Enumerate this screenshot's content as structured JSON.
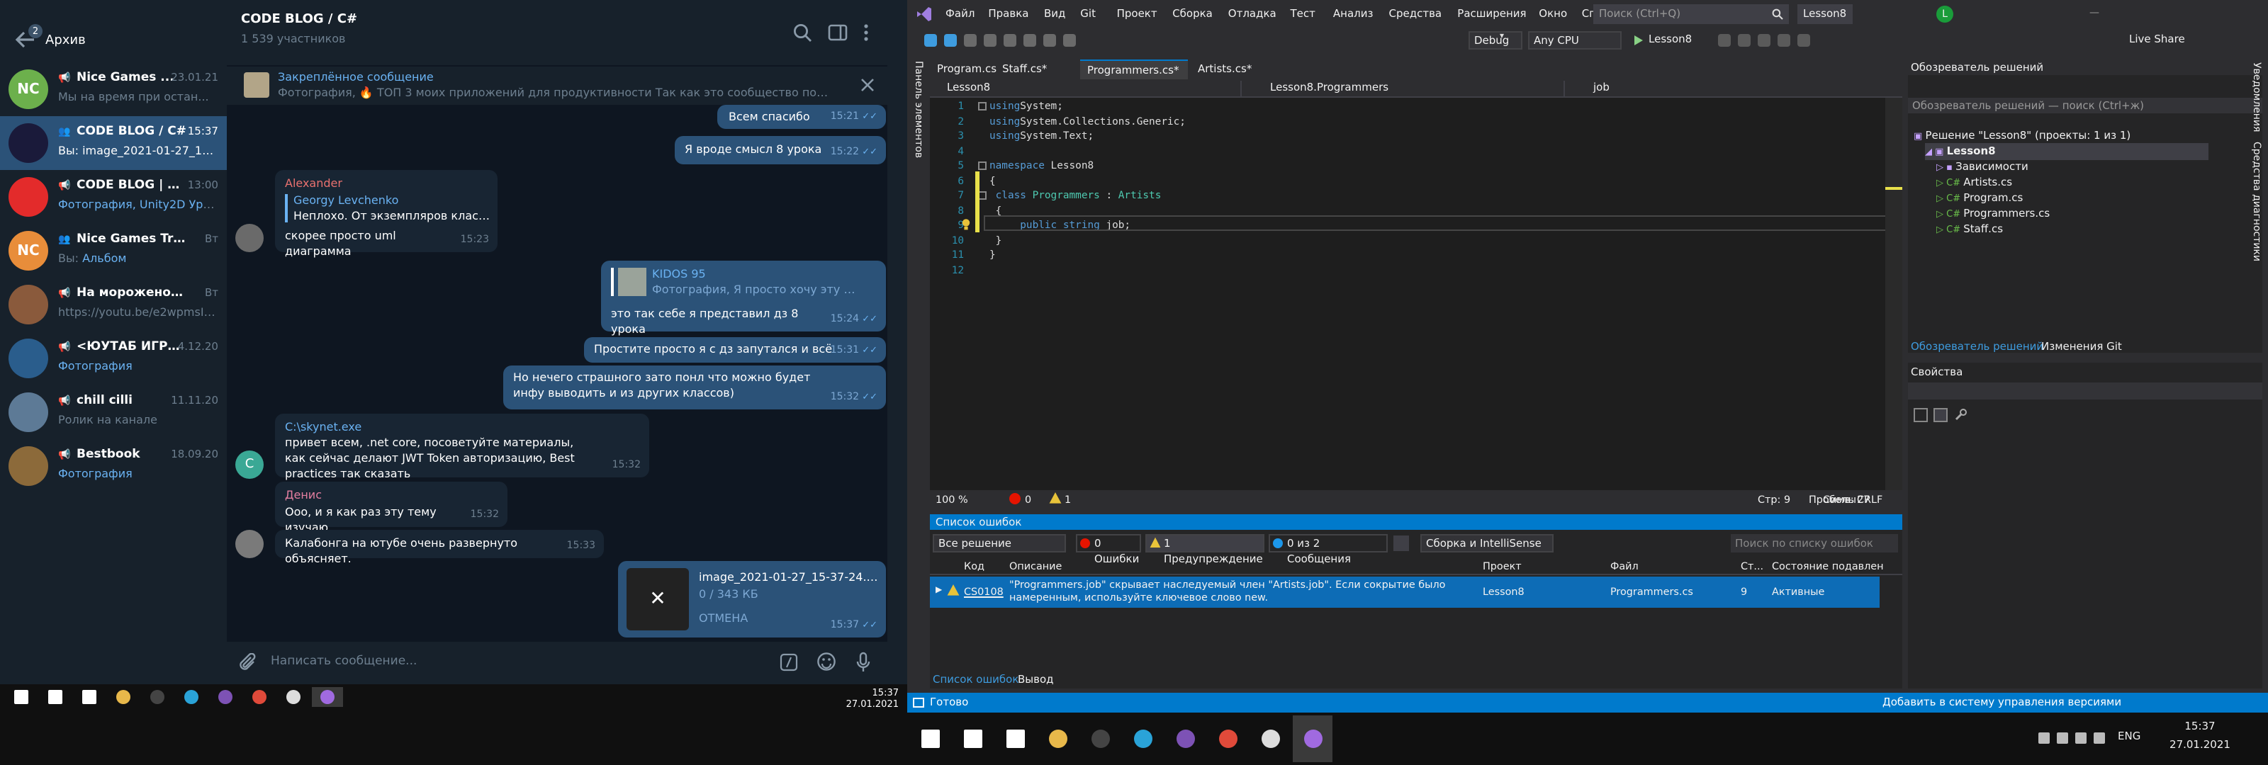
{
  "telegram": {
    "archive": {
      "label": "Архив",
      "badge": "2"
    },
    "chats": [
      {
        "avatar_text": "NC",
        "avatar_color": "#6cb04c",
        "title": "Nice Games ...",
        "time": "23.01.21",
        "sender": "",
        "preview": "Мы на время при остан...",
        "icon": "megaphone-icon",
        "active": false
      },
      {
        "avatar_text": "",
        "avatar_color": "#1a1a3a",
        "title": "CODE BLOG / C#",
        "time": "15:37",
        "sender": "Вы: ",
        "preview": "image_2021-01-27_15-37...",
        "icon": "group-icon",
        "active": true
      },
      {
        "avatar_text": "",
        "avatar_color": "#e32b2b",
        "title": "CODE BLOG | Про...",
        "time": "13:00",
        "sender": "",
        "preview": "Фотография, Unity2D Уроки...",
        "icon": "megaphone-icon",
        "active": false
      },
      {
        "avatar_text": "NC",
        "avatar_color": "#e88d3a",
        "title": "Nice Games Traini...",
        "time": "Вт",
        "sender": "Вы: ",
        "preview": "Альбом",
        "icon": "group-icon",
        "active": false
      },
      {
        "avatar_text": "",
        "avatar_color": "#8a5a3c",
        "title": "На мороженое актеру",
        "time": "Вт",
        "sender": "",
        "preview": "https://youtu.be/e2wpmsIJmf0",
        "icon": "megaphone-icon",
        "active": false
      },
      {
        "avatar_text": "",
        "avatar_color": "#2a5d8c",
        "title": "<ЮУТАБ ИГРЫ>",
        "time": "4.12.20",
        "sender": "",
        "preview": "Фотография",
        "icon": "megaphone-icon",
        "active": false
      },
      {
        "avatar_text": "",
        "avatar_color": "#5d7a96",
        "title": "chill cilli",
        "time": "11.11.20",
        "sender": "",
        "preview": "Ролик на канале",
        "icon": "megaphone-icon",
        "active": false
      },
      {
        "avatar_text": "",
        "avatar_color": "#8c6a3a",
        "title": "Bestbook",
        "time": "18.09.20",
        "sender": "",
        "preview": "Фотография",
        "icon": "megaphone-icon",
        "active": false
      }
    ],
    "header": {
      "title": "CODE BLOG / C#",
      "subtitle": "1 539 участников"
    },
    "pinned": {
      "title": "Закреплённое сообщение",
      "text": "Фотография, 🔥 ТОП 3 моих приложений для продуктивности  Так как это сообщество посвящено и..."
    },
    "messages": [
      {
        "text": "Всем спасибо",
        "time": "15:21"
      },
      {
        "text": "Я вроде смысл 8 урока",
        "time": "15:22"
      },
      {
        "sender": "Alexander",
        "reply_name": "Georgy Levchenko",
        "reply_text": "Неплохо. От экземпляров класса ...",
        "text": "скорее просто uml диаграмма",
        "time": "15:23"
      },
      {
        "reply_name": "KIDOS 95",
        "reply_text": "Фотография, Я просто хочу эту штук...",
        "text": "это так себе я представил дз 8 урока",
        "time": "15:24"
      },
      {
        "text": "Простите просто я с дз запутался и всё",
        "time": "15:31"
      },
      {
        "text": "Но нечего страшного зато понл что можно будет инфу выводить и из  других классов)",
        "time": "15:32"
      },
      {
        "sender": "C:\\skynet.exe",
        "avatar_text": "C",
        "text": "привет всем, .net core, посоветуйте материалы, как сейчас делают JWT Token авторизацию, Best practices так сказать",
        "time": "15:32"
      },
      {
        "sender": "Денис",
        "text": "Ооо, и я как раз эту тему изучаю",
        "time": "15:32"
      },
      {
        "text": "Калабонга на ютубе очень развернуто объясняет.",
        "time": "15:33"
      },
      {
        "file_name": "image_2021-01-27_15-37-24.png",
        "file_size": "0 / 343 КБ",
        "cancel": "ОТМЕНА",
        "time": "15:37"
      }
    ],
    "input_placeholder": "Написать сообщение...",
    "taskbar_clock": {
      "time": "15:37",
      "date": "27.01.2021"
    }
  },
  "vs": {
    "menu": [
      "Файл",
      "Правка",
      "Вид",
      "Git",
      "Проект",
      "Сборка",
      "Отладка",
      "Тест",
      "Анализ",
      "Средства",
      "Расширения",
      "Окно",
      "Справка"
    ],
    "search_placeholder": "Поиск (Ctrl+Q)",
    "solution_title": "Lesson8",
    "user_initial": "L",
    "live_share": "Live Share",
    "toolbar": {
      "config": "Debug",
      "platform": "Any CPU",
      "run": "Lesson8"
    },
    "left_tool": "Панель элементов",
    "tabs": [
      "Program.cs",
      "Staff.cs*",
      "Programmers.cs*",
      "Artists.cs*"
    ],
    "active_tab": 2,
    "nav": {
      "project": "Lesson8",
      "class": "Lesson8.Programmers",
      "member": "job"
    },
    "code_lines": [
      {
        "n": "1",
        "parts": [
          [
            "kw",
            "using"
          ],
          [
            "",
            "System;"
          ]
        ]
      },
      {
        "n": "2",
        "parts": [
          [
            "kw",
            "using"
          ],
          [
            "",
            "System.Collections.Generic;"
          ]
        ]
      },
      {
        "n": "3",
        "parts": [
          [
            "kw",
            "using"
          ],
          [
            "",
            "System.Text;"
          ]
        ]
      },
      {
        "n": "4",
        "parts": []
      },
      {
        "n": "5",
        "parts": [
          [
            "kw",
            "namespace"
          ],
          [
            "",
            " Lesson8"
          ]
        ]
      },
      {
        "n": "6",
        "parts": [
          [
            "",
            "{"
          ]
        ]
      },
      {
        "n": "7",
        "parts": [
          [
            "",
            " "
          ],
          [
            "kw",
            "class"
          ],
          [
            "",
            " "
          ],
          [
            "ty",
            "Programmers"
          ],
          [
            "",
            " : "
          ],
          [
            "ty",
            "Artists"
          ]
        ]
      },
      {
        "n": "8",
        "parts": [
          [
            "",
            " {"
          ]
        ]
      },
      {
        "n": "9",
        "parts": [
          [
            "",
            "     "
          ],
          [
            "kw",
            "public"
          ],
          [
            "",
            " "
          ],
          [
            "kw",
            "string"
          ],
          [
            "",
            " job;"
          ]
        ]
      },
      {
        "n": "10",
        "parts": [
          [
            "",
            " }"
          ]
        ]
      },
      {
        "n": "11",
        "parts": [
          [
            "",
            "}"
          ]
        ]
      },
      {
        "n": "12",
        "parts": []
      }
    ],
    "editor_status": {
      "zoom": "100 %",
      "errors": "0",
      "warnings": "1",
      "line": "Стр: 9",
      "col": "Симв: 27",
      "spaces": "Пробелы",
      "eol": "CRLF"
    },
    "error_list": {
      "title": "Список ошибок",
      "scope": "Все решение",
      "errors_btn": "0 Ошибки",
      "warnings_btn": "1 Предупреждение",
      "messages_btn": "0 из 2 Сообщения",
      "build_filter": "Сборка и IntelliSense",
      "search_placeholder": "Поиск по списку ошибок",
      "columns": [
        "Код",
        "Описание",
        "Проект",
        "Файл",
        "Ст...",
        "Состояние подавлен"
      ],
      "row": {
        "code": "CS0108",
        "description": "\"Programmers.job\" скрывает наследуемый член \"Artists.job\". Если сокрытие было намеренным, используйте ключевое слово new.",
        "project": "Lesson8",
        "file": "Programmers.cs",
        "line": "9",
        "state": "Активные"
      },
      "bottom_tabs": [
        "Список ошибок",
        "Вывод"
      ]
    },
    "solution_explorer": {
      "title": "Обозреватель решений",
      "search_placeholder": "Обозреватель решений — поиск (Ctrl+ж)",
      "items": [
        {
          "label": "Решение \"Lesson8\" (проекты: 1 из 1)",
          "indent": 0,
          "bold": false
        },
        {
          "label": "Lesson8",
          "indent": 1,
          "bold": true
        },
        {
          "label": "Зависимости",
          "indent": 2,
          "bold": false
        },
        {
          "label": "Artists.cs",
          "indent": 2,
          "bold": false,
          "prefix": "C#"
        },
        {
          "label": "Program.cs",
          "indent": 2,
          "bold": false,
          "prefix": "C#"
        },
        {
          "label": "Programmers.cs",
          "indent": 2,
          "bold": false,
          "prefix": "C#"
        },
        {
          "label": "Staff.cs",
          "indent": 2,
          "bold": false,
          "prefix": "C#"
        }
      ],
      "bottom_tabs": [
        "Обозреватель решений",
        "Изменения Git"
      ]
    },
    "properties_title": "Свойства",
    "right_rail": [
      "Уведомления",
      "Средства диагностики"
    ],
    "statusbar": {
      "ready": "Готово",
      "vcs": "Добавить в систему управления версиями"
    },
    "taskbar_clock": {
      "time": "15:37",
      "date": "27.01.2021"
    },
    "taskbar_lang": "ENG"
  }
}
